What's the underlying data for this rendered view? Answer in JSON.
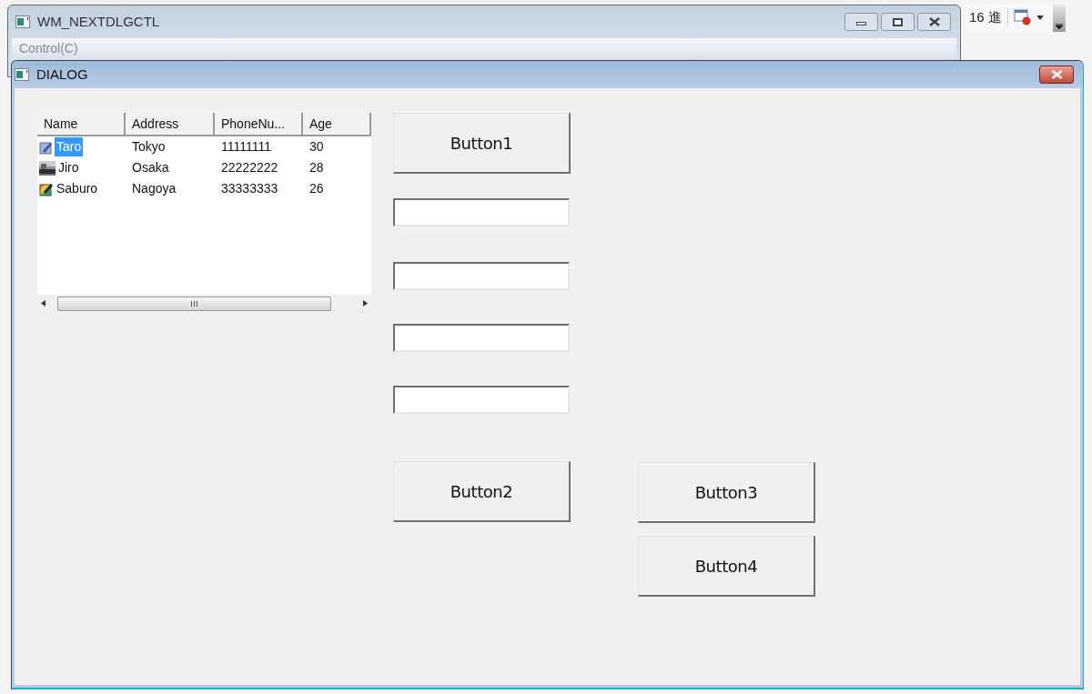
{
  "background_window": {
    "title": "WM_NEXTDLGCTL",
    "menu": [
      "Control(C)"
    ]
  },
  "toolbar": {
    "label": "16 進"
  },
  "dialog": {
    "title": "DIALOG",
    "list": {
      "columns": [
        "Name",
        "Address",
        "PhoneNu...",
        "Age"
      ],
      "rows": [
        {
          "cells": [
            "Taro",
            "Tokyo",
            "11111111",
            "30"
          ],
          "selected": true
        },
        {
          "cells": [
            "Jiro",
            "Osaka",
            "22222222",
            "28"
          ],
          "selected": false
        },
        {
          "cells": [
            "Saburo",
            "Nagoya",
            "33333333",
            "26"
          ],
          "selected": false
        }
      ]
    },
    "middle": [
      {
        "kind": "button",
        "label": "Button1"
      },
      {
        "kind": "edit"
      },
      {
        "kind": "edit"
      },
      {
        "kind": "edit"
      },
      {
        "kind": "edit"
      },
      {
        "kind": "button",
        "label": "Button2"
      }
    ],
    "right": [
      {
        "kind": "button",
        "label": "Button3"
      },
      {
        "kind": "button",
        "label": "Button4"
      }
    ]
  }
}
